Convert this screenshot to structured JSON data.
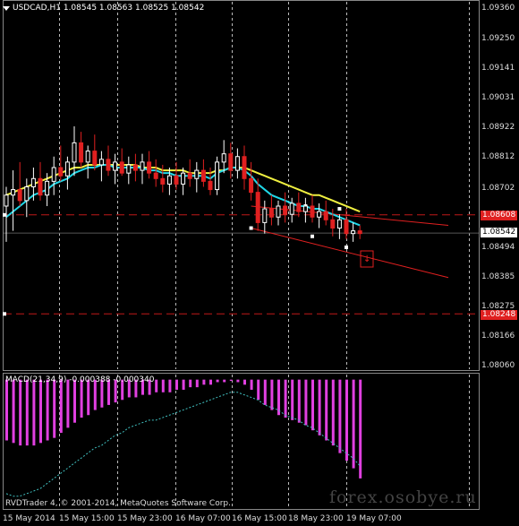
{
  "header": {
    "symbol": "USDCAD,H1",
    "ohlc": "1.08545 1.08563 1.08525 1.08542"
  },
  "price_axis": {
    "labels": [
      "1.09360",
      "1.09250",
      "1.09141",
      "1.09031",
      "1.08922",
      "1.08812",
      "1.08702",
      "1.08494",
      "1.08385",
      "1.08275",
      "1.08166",
      "1.08060"
    ],
    "current_price": "1.08542",
    "resistance_level": "1.08608",
    "support_level": "1.08248"
  },
  "time_axis": {
    "labels": [
      "15 May 2014",
      "15 May 15:00",
      "15 May 23:00",
      "16 May 07:00",
      "16 May 15:00",
      "18 May 23:00",
      "19 May 07:00"
    ]
  },
  "indicator": {
    "label": "MACD(21,34,9) -0.000388 -0.000340"
  },
  "footer": {
    "copyright": "RVDTrader 4, © 2001-2014, MetaQuotes Software Corp.",
    "watermark": "forex.osobye.ru"
  },
  "colors": {
    "background": "#000000",
    "bull_candle": "#ffffff",
    "bear_candle": "#e02020",
    "ma_fast": "#20d8e8",
    "ma_slow": "#f0f040",
    "macd_histogram": "#e040e0",
    "macd_signal": "#40c0c0",
    "level_lines": "#c01818",
    "grid": "#ffffff"
  },
  "chart_data": {
    "type": "candlestick",
    "symbol": "USDCAD",
    "timeframe": "H1",
    "ylim": [
      1.0806,
      1.0936
    ],
    "candles": [
      {
        "o": 1.0864,
        "h": 1.0871,
        "l": 1.0851,
        "c": 1.0868
      },
      {
        "o": 1.0868,
        "h": 1.0877,
        "l": 1.0855,
        "c": 1.087
      },
      {
        "o": 1.087,
        "h": 1.088,
        "l": 1.0864,
        "c": 1.0866
      },
      {
        "o": 1.0866,
        "h": 1.0874,
        "l": 1.086,
        "c": 1.0871
      },
      {
        "o": 1.0871,
        "h": 1.0878,
        "l": 1.0866,
        "c": 1.0874
      },
      {
        "o": 1.0874,
        "h": 1.088,
        "l": 1.0866,
        "c": 1.0868
      },
      {
        "o": 1.0868,
        "h": 1.0876,
        "l": 1.0864,
        "c": 1.0873
      },
      {
        "o": 1.0873,
        "h": 1.0882,
        "l": 1.0868,
        "c": 1.0878
      },
      {
        "o": 1.0878,
        "h": 1.0886,
        "l": 1.0873,
        "c": 1.0875
      },
      {
        "o": 1.0875,
        "h": 1.0882,
        "l": 1.087,
        "c": 1.088
      },
      {
        "o": 1.088,
        "h": 1.0893,
        "l": 1.0875,
        "c": 1.0887
      },
      {
        "o": 1.0887,
        "h": 1.0891,
        "l": 1.0878,
        "c": 1.088
      },
      {
        "o": 1.088,
        "h": 1.0886,
        "l": 1.0874,
        "c": 1.0884
      },
      {
        "o": 1.0884,
        "h": 1.089,
        "l": 1.0877,
        "c": 1.0879
      },
      {
        "o": 1.0879,
        "h": 1.0884,
        "l": 1.0873,
        "c": 1.0881
      },
      {
        "o": 1.0881,
        "h": 1.0886,
        "l": 1.0875,
        "c": 1.0877
      },
      {
        "o": 1.0877,
        "h": 1.0883,
        "l": 1.0872,
        "c": 1.088
      },
      {
        "o": 1.088,
        "h": 1.0885,
        "l": 1.0875,
        "c": 1.0876
      },
      {
        "o": 1.0876,
        "h": 1.0882,
        "l": 1.0872,
        "c": 1.0879
      },
      {
        "o": 1.0879,
        "h": 1.0883,
        "l": 1.0873,
        "c": 1.0877
      },
      {
        "o": 1.0877,
        "h": 1.0883,
        "l": 1.0872,
        "c": 1.088
      },
      {
        "o": 1.088,
        "h": 1.0884,
        "l": 1.0874,
        "c": 1.0876
      },
      {
        "o": 1.0876,
        "h": 1.0881,
        "l": 1.0871,
        "c": 1.0874
      },
      {
        "o": 1.0874,
        "h": 1.0879,
        "l": 1.0869,
        "c": 1.0872
      },
      {
        "o": 1.0872,
        "h": 1.0878,
        "l": 1.0868,
        "c": 1.0875
      },
      {
        "o": 1.0875,
        "h": 1.088,
        "l": 1.087,
        "c": 1.0872
      },
      {
        "o": 1.0872,
        "h": 1.0878,
        "l": 1.0868,
        "c": 1.0876
      },
      {
        "o": 1.0876,
        "h": 1.0881,
        "l": 1.0871,
        "c": 1.0874
      },
      {
        "o": 1.0874,
        "h": 1.088,
        "l": 1.0869,
        "c": 1.0877
      },
      {
        "o": 1.0877,
        "h": 1.0881,
        "l": 1.0871,
        "c": 1.0873
      },
      {
        "o": 1.0873,
        "h": 1.0878,
        "l": 1.0868,
        "c": 1.087
      },
      {
        "o": 1.087,
        "h": 1.0882,
        "l": 1.0868,
        "c": 1.088
      },
      {
        "o": 1.088,
        "h": 1.0888,
        "l": 1.0876,
        "c": 1.0883
      },
      {
        "o": 1.0883,
        "h": 1.0887,
        "l": 1.0874,
        "c": 1.0877
      },
      {
        "o": 1.0877,
        "h": 1.0885,
        "l": 1.0874,
        "c": 1.0882
      },
      {
        "o": 1.0882,
        "h": 1.0886,
        "l": 1.087,
        "c": 1.0874
      },
      {
        "o": 1.0874,
        "h": 1.088,
        "l": 1.0866,
        "c": 1.0869
      },
      {
        "o": 1.0869,
        "h": 1.0874,
        "l": 1.0855,
        "c": 1.0858
      },
      {
        "o": 1.0858,
        "h": 1.0866,
        "l": 1.0854,
        "c": 1.0863
      },
      {
        "o": 1.0863,
        "h": 1.0868,
        "l": 1.0857,
        "c": 1.086
      },
      {
        "o": 1.086,
        "h": 1.0866,
        "l": 1.0857,
        "c": 1.0864
      },
      {
        "o": 1.0864,
        "h": 1.0869,
        "l": 1.0858,
        "c": 1.0861
      },
      {
        "o": 1.0861,
        "h": 1.0867,
        "l": 1.0858,
        "c": 1.0865
      },
      {
        "o": 1.0865,
        "h": 1.0869,
        "l": 1.086,
        "c": 1.0862
      },
      {
        "o": 1.0862,
        "h": 1.0867,
        "l": 1.0858,
        "c": 1.0864
      },
      {
        "o": 1.0864,
        "h": 1.0868,
        "l": 1.0858,
        "c": 1.086
      },
      {
        "o": 1.086,
        "h": 1.0865,
        "l": 1.0856,
        "c": 1.0862
      },
      {
        "o": 1.0862,
        "h": 1.0866,
        "l": 1.0857,
        "c": 1.0859
      },
      {
        "o": 1.0859,
        "h": 1.0863,
        "l": 1.0853,
        "c": 1.0856
      },
      {
        "o": 1.0856,
        "h": 1.0861,
        "l": 1.0852,
        "c": 1.0859
      },
      {
        "o": 1.0859,
        "h": 1.0863,
        "l": 1.0852,
        "c": 1.0854
      },
      {
        "o": 1.0854,
        "h": 1.0858,
        "l": 1.0851,
        "c": 1.0855
      },
      {
        "o": 1.0855,
        "h": 1.0857,
        "l": 1.0852,
        "c": 1.0854
      }
    ],
    "ma_fast": [
      1.086,
      1.0862,
      1.0864,
      1.0866,
      1.0868,
      1.0869,
      1.087,
      1.0872,
      1.0873,
      1.0874,
      1.0876,
      1.0877,
      1.0878,
      1.0878,
      1.0879,
      1.0879,
      1.0878,
      1.0878,
      1.0878,
      1.0878,
      1.0878,
      1.0877,
      1.0877,
      1.0876,
      1.0876,
      1.0875,
      1.0875,
      1.0875,
      1.0875,
      1.0875,
      1.0874,
      1.0876,
      1.0877,
      1.0878,
      1.0878,
      1.0877,
      1.0875,
      1.0872,
      1.087,
      1.0868,
      1.0867,
      1.0866,
      1.0865,
      1.0864,
      1.0864,
      1.0863,
      1.0863,
      1.0862,
      1.0861,
      1.086,
      1.0859,
      1.0858,
      1.0857
    ],
    "ma_slow": [
      1.0868,
      1.0869,
      1.087,
      1.0871,
      1.0872,
      1.0873,
      1.0874,
      1.0875,
      1.0876,
      1.0877,
      1.0878,
      1.0878,
      1.0879,
      1.0879,
      1.0879,
      1.0879,
      1.0879,
      1.0879,
      1.0879,
      1.0879,
      1.0878,
      1.0878,
      1.0878,
      1.0877,
      1.0877,
      1.0877,
      1.0877,
      1.0876,
      1.0876,
      1.0876,
      1.0876,
      1.0877,
      1.0877,
      1.0878,
      1.0878,
      1.0878,
      1.0877,
      1.0876,
      1.0875,
      1.0874,
      1.0873,
      1.0872,
      1.0871,
      1.087,
      1.0869,
      1.0868,
      1.0868,
      1.0867,
      1.0866,
      1.0865,
      1.0864,
      1.0863,
      1.0862
    ],
    "resistance_level": 1.08608,
    "support_level": 1.08248,
    "channel_upper": {
      "from": [
        36,
        1.0864
      ],
      "to": [
        65,
        1.0857
      ]
    },
    "channel_lower": {
      "from": [
        36,
        1.0856
      ],
      "to": [
        65,
        1.0838
      ]
    },
    "macd": {
      "params": "21,34,9",
      "value": -0.000388,
      "signal": -0.00034,
      "histogram": [
        -0.00024,
        -0.00025,
        -0.00026,
        -0.00026,
        -0.00026,
        -0.00025,
        -0.00024,
        -0.00023,
        -0.00021,
        -0.00019,
        -0.00017,
        -0.00015,
        -0.00014,
        -0.00012,
        -0.00011,
        -0.0001,
        -9e-05,
        -8e-05,
        -7e-05,
        -7e-05,
        -6e-05,
        -6e-05,
        -5e-05,
        -5e-05,
        -5e-05,
        -4e-05,
        -4e-05,
        -3e-05,
        -3e-05,
        -2e-05,
        -2e-05,
        -1e-05,
        -1e-05,
        -5e-06,
        -1e-05,
        -2e-05,
        -4e-05,
        -8e-05,
        -0.0001,
        -0.00012,
        -0.00014,
        -0.00015,
        -0.00016,
        -0.00017,
        -0.00018,
        -0.0002,
        -0.00022,
        -0.00024,
        -0.00026,
        -0.00029,
        -0.00032,
        -0.00035,
        -0.00039
      ],
      "signal_line": [
        -0.00045,
        -0.00046,
        -0.00046,
        -0.00045,
        -0.00044,
        -0.00043,
        -0.00041,
        -0.00039,
        -0.00037,
        -0.00035,
        -0.00033,
        -0.00031,
        -0.00029,
        -0.00027,
        -0.00026,
        -0.00024,
        -0.00022,
        -0.00021,
        -0.00019,
        -0.00018,
        -0.00017,
        -0.00016,
        -0.00016,
        -0.00015,
        -0.00014,
        -0.00013,
        -0.00012,
        -0.00011,
        -0.0001,
        -9e-05,
        -8e-05,
        -7e-05,
        -6e-05,
        -5e-05,
        -5e-05,
        -6e-05,
        -7e-05,
        -8e-05,
        -0.0001,
        -0.00011,
        -0.00012,
        -0.00014,
        -0.00015,
        -0.00016,
        -0.00018,
        -0.00019,
        -0.00021,
        -0.00023,
        -0.00025,
        -0.00027,
        -0.00029,
        -0.00031,
        -0.00034
      ],
      "ylim": [
        -0.0005,
        2e-05
      ]
    }
  }
}
